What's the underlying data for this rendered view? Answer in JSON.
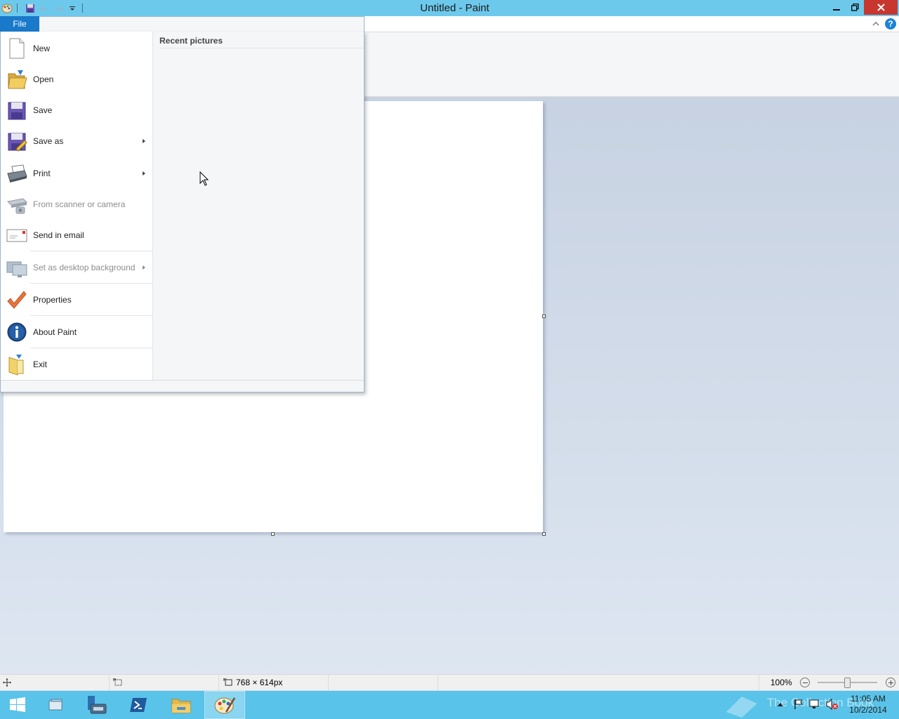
{
  "window": {
    "title": "Untitled - Paint"
  },
  "ribbon": {
    "file_tab": "File",
    "help_label": "?"
  },
  "file_menu": {
    "items": [
      {
        "label": "New",
        "icon": "new-page-icon"
      },
      {
        "label": "Open",
        "icon": "open-folder-icon"
      },
      {
        "label": "Save",
        "icon": "floppy-disk-icon"
      },
      {
        "label": "Save as",
        "icon": "save-as-icon",
        "submenu": true
      },
      {
        "label": "Print",
        "icon": "printer-icon",
        "submenu": true
      },
      {
        "label": "From scanner or camera",
        "icon": "scanner-icon",
        "disabled": true
      },
      {
        "label": "Send in email",
        "icon": "email-icon"
      },
      {
        "label": "Set as desktop background",
        "icon": "desktop-background-icon",
        "disabled": true,
        "submenu": true
      },
      {
        "label": "Properties",
        "icon": "checkmark-icon"
      },
      {
        "label": "About Paint",
        "icon": "info-icon"
      },
      {
        "label": "Exit",
        "icon": "exit-icon"
      }
    ],
    "recent_header": "Recent pictures"
  },
  "statusbar": {
    "image_size": "768 × 614px",
    "zoom": "100%"
  },
  "taskbar": {
    "clock_time": "11:05 AM",
    "clock_date": "10/2/2014",
    "watermark": "The Collection Book"
  },
  "colors": {
    "titlebar": "#6dc9ec",
    "file_tab": "#1979ca",
    "taskbar": "#5ac3e9"
  }
}
